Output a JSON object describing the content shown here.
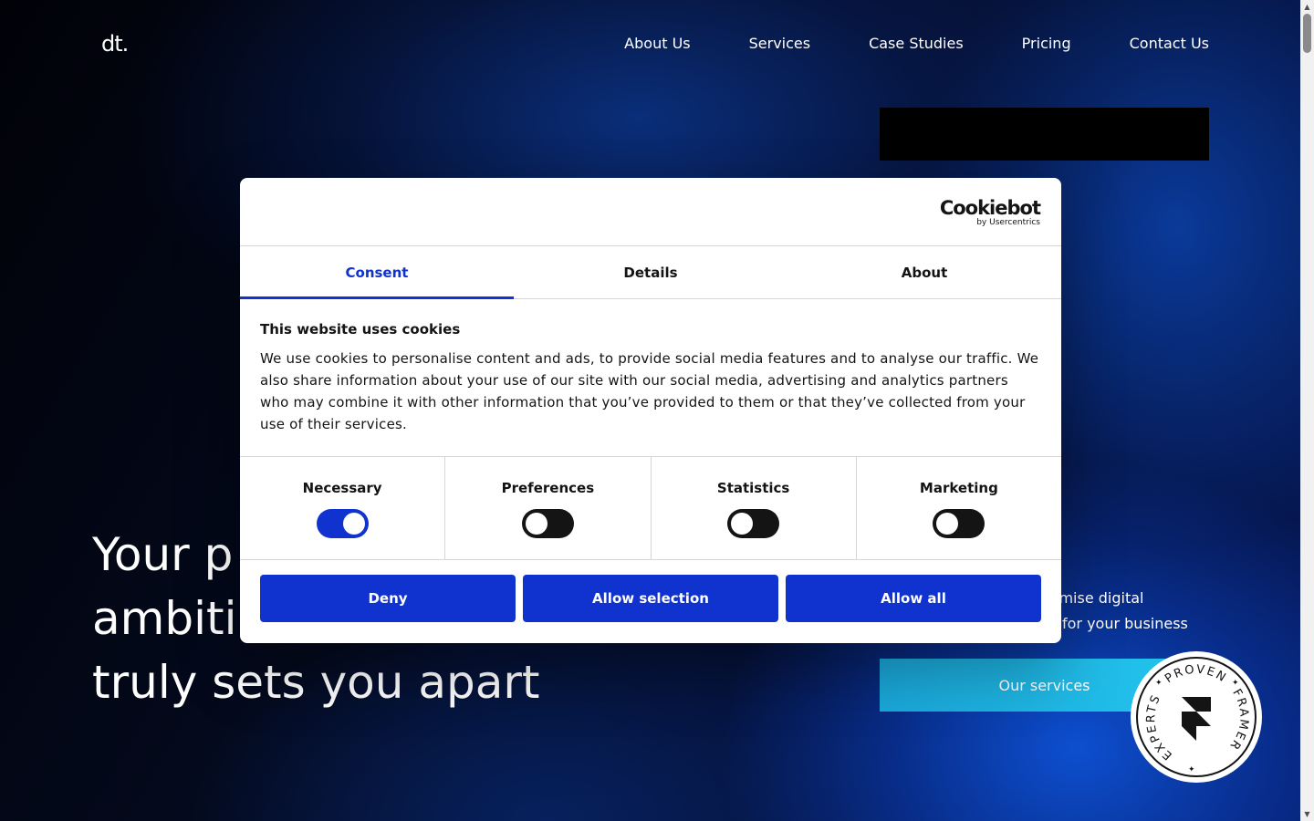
{
  "site": {
    "logo": "dt.",
    "nav": [
      "About Us",
      "Services",
      "Case Studies",
      "Pricing",
      "Contact Us"
    ],
    "headline_lines": [
      "Your p",
      "ambiti",
      "truly sets you apart"
    ],
    "hero_text_lines": [
      "imise digital",
      "for your business"
    ],
    "services_button": "Our services",
    "badge": {
      "top_text": "PROVEN",
      "right_text": "FRAMER",
      "left_text": "EXPERTS",
      "icon": "framer-icon"
    }
  },
  "cookie_dialog": {
    "brand": {
      "name": "Cookiebot",
      "sub": "by Usercentrics"
    },
    "tabs": [
      {
        "label": "Consent",
        "active": true
      },
      {
        "label": "Details",
        "active": false
      },
      {
        "label": "About",
        "active": false
      }
    ],
    "title": "This website uses cookies",
    "text": "We use cookies to personalise content and ads, to provide social media features and to analyse our traffic. We also share information about your use of our site with our social media, advertising and analytics partners who may combine it with other information that you’ve provided to them or that they’ve collected from your use of their services.",
    "toggles": [
      {
        "label": "Necessary",
        "on": true
      },
      {
        "label": "Preferences",
        "on": false
      },
      {
        "label": "Statistics",
        "on": false
      },
      {
        "label": "Marketing",
        "on": false
      }
    ],
    "buttons": {
      "deny": "Deny",
      "allow_selection": "Allow selection",
      "allow_all": "Allow all"
    },
    "accent_color": "#1032cf"
  }
}
